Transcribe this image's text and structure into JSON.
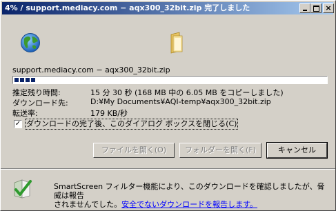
{
  "window": {
    "title": "4% / support.mediacy.com − aqx300_32bit.zip 完了しました",
    "minimize_glyph": "_",
    "close_glyph": "×"
  },
  "icons": {
    "globe": "globe-icon",
    "folder": "folder-icon",
    "shield": "smartscreen-shield-icon"
  },
  "download": {
    "source_line": "support.mediacy.com − aqx300_32bit.zip",
    "progress_percent": 4,
    "progress_blocks": 4,
    "rows": [
      {
        "label": "推定残り時間:",
        "value": "15 分 30 秒 (168 MB 中の 6.05 MB をコピーしました)"
      },
      {
        "label": "ダウンロード先:",
        "value": "D:¥My Documents¥AQI-temp¥aqx300_32bit.zip"
      },
      {
        "label": "転送率:",
        "value": "179 KB/秒"
      }
    ],
    "close_on_complete_checked": true,
    "close_on_complete_label": "ダウンロードの完了後、このダイアログ ボックスを閉じる(C)"
  },
  "buttons": {
    "open_file": "ファイルを開く(O)",
    "open_folder": "フォルダーを開く(F)",
    "cancel": "キャンセル"
  },
  "smartscreen": {
    "line1": "SmartScreen フィルター機能により、このダウンロードを確認しましたが、脅威は報告",
    "line2_prefix": "されませんでした。",
    "link": "安全でないダウンロードを報告します。"
  }
}
